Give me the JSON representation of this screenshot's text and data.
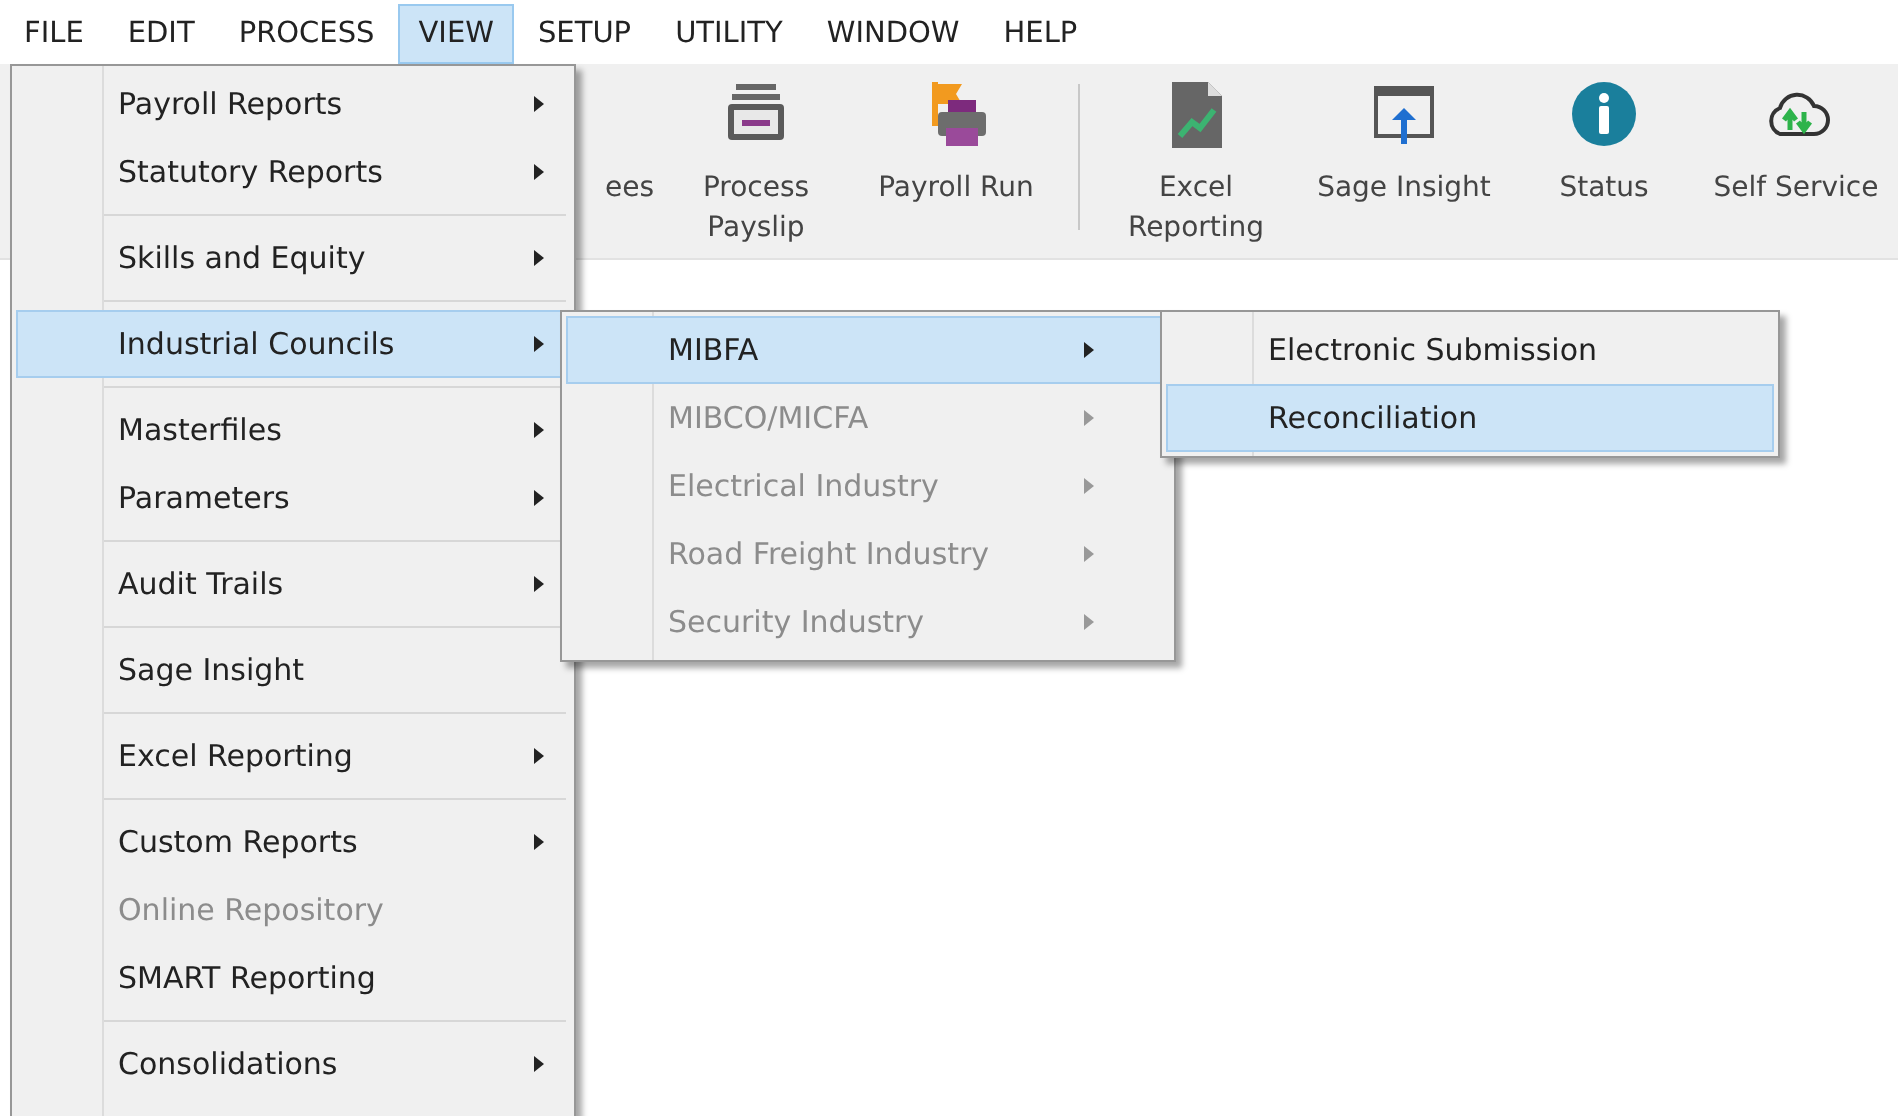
{
  "menubar": [
    {
      "label": "FILE",
      "selected": false
    },
    {
      "label": "EDIT",
      "selected": false
    },
    {
      "label": "PROCESS",
      "selected": false
    },
    {
      "label": "VIEW",
      "selected": true
    },
    {
      "label": "SETUP",
      "selected": false
    },
    {
      "label": "UTILITY",
      "selected": false
    },
    {
      "label": "WINDOW",
      "selected": false
    },
    {
      "label": "HELP",
      "selected": false
    }
  ],
  "toolbar": [
    [
      {
        "kind": "partial",
        "lines": [
          "ees"
        ]
      },
      {
        "kind": "payslip",
        "lines": [
          "Process",
          "Payslip"
        ]
      },
      {
        "kind": "payroll",
        "lines": [
          "Payroll Run"
        ]
      }
    ],
    [
      {
        "kind": "excel",
        "lines": [
          "Excel",
          "Reporting"
        ]
      },
      {
        "kind": "insight",
        "lines": [
          "Sage Insight"
        ]
      },
      {
        "kind": "status",
        "lines": [
          "Status"
        ]
      },
      {
        "kind": "cloud",
        "lines": [
          "Self Service"
        ]
      }
    ]
  ],
  "view_menu": [
    [
      {
        "label": "Payroll Reports",
        "submenu": true,
        "selected": false,
        "disabled": false
      },
      {
        "label": "Statutory Reports",
        "submenu": true,
        "selected": false,
        "disabled": false
      }
    ],
    [
      {
        "label": "Skills and Equity",
        "submenu": true,
        "selected": false,
        "disabled": false
      }
    ],
    [
      {
        "label": "Industrial Councils",
        "submenu": true,
        "selected": true,
        "disabled": false
      }
    ],
    [
      {
        "label": "Masterfiles",
        "submenu": true,
        "selected": false,
        "disabled": false
      },
      {
        "label": "Parameters",
        "submenu": true,
        "selected": false,
        "disabled": false
      }
    ],
    [
      {
        "label": "Audit Trails",
        "submenu": true,
        "selected": false,
        "disabled": false
      }
    ],
    [
      {
        "label": "Sage Insight",
        "submenu": false,
        "selected": false,
        "disabled": false
      }
    ],
    [
      {
        "label": "Excel Reporting",
        "submenu": true,
        "selected": false,
        "disabled": false
      }
    ],
    [
      {
        "label": "Custom Reports",
        "submenu": true,
        "selected": false,
        "disabled": false
      },
      {
        "label": "Online Repository",
        "submenu": false,
        "selected": false,
        "disabled": true
      },
      {
        "label": "SMART Reporting",
        "submenu": false,
        "selected": false,
        "disabled": false
      }
    ],
    [
      {
        "label": "Consolidations",
        "submenu": true,
        "selected": false,
        "disabled": false
      }
    ]
  ],
  "industrial_councils_menu": [
    [
      {
        "label": "MIBFA",
        "submenu": true,
        "selected": true,
        "disabled": false
      },
      {
        "label": "MIBCO/MICFA",
        "submenu": true,
        "selected": false,
        "disabled": true
      },
      {
        "label": "Electrical Industry",
        "submenu": true,
        "selected": false,
        "disabled": true
      },
      {
        "label": "Road Freight Industry",
        "submenu": true,
        "selected": false,
        "disabled": true
      },
      {
        "label": "Security Industry",
        "submenu": true,
        "selected": false,
        "disabled": true
      }
    ]
  ],
  "mibfa_menu": [
    [
      {
        "label": "Electronic Submission",
        "submenu": false,
        "selected": false,
        "disabled": false
      },
      {
        "label": "Reconciliation",
        "submenu": false,
        "selected": true,
        "disabled": false
      }
    ]
  ]
}
